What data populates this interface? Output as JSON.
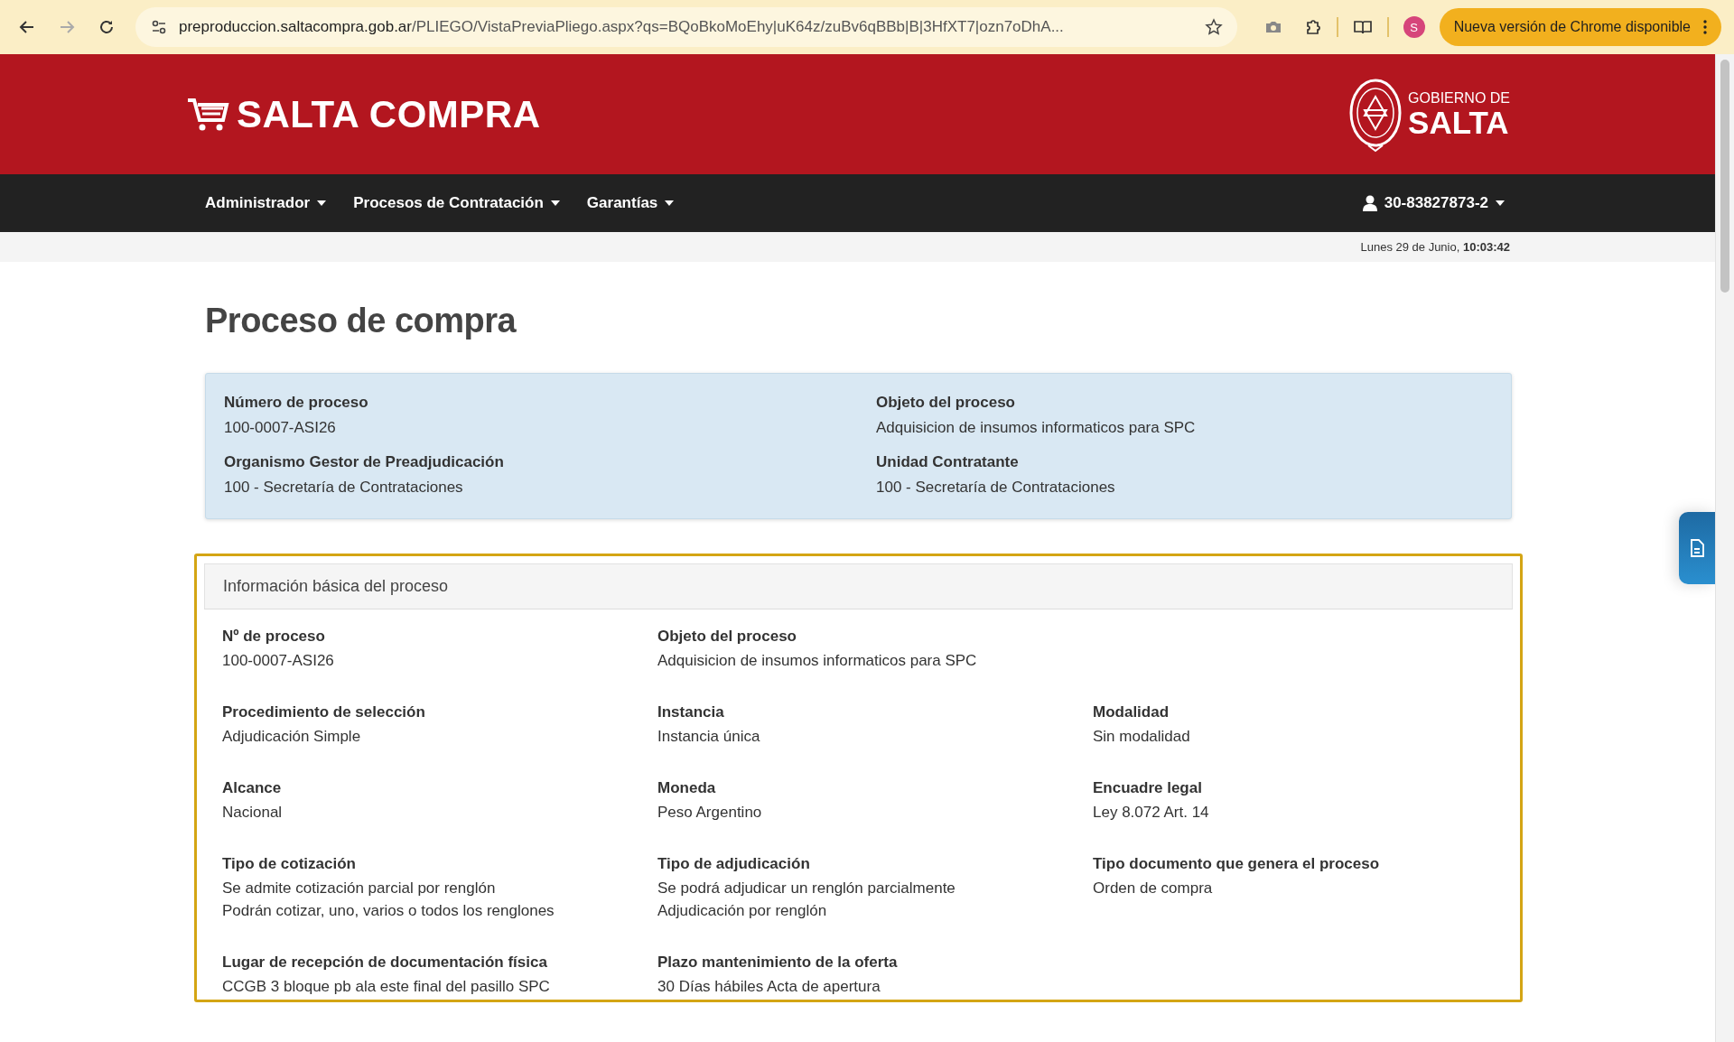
{
  "browser": {
    "url_host": "preproduccion.saltacompra.gob.ar",
    "url_path": "/PLIEGO/VistaPreviaPliego.aspx?qs=BQoBkoMoEhy|uK64z/zuBv6qBBb|B|3HfXT7|ozn7oDhA...",
    "profile": "S",
    "update_button": "Nueva versión de Chrome disponible"
  },
  "header": {
    "logo": "SALTA COMPRA",
    "gov_line1": "GOBIERNO DE",
    "gov_line2": "SALTA"
  },
  "nav": {
    "items": [
      {
        "label": "Administrador"
      },
      {
        "label": "Procesos de Contratación"
      },
      {
        "label": "Garantías"
      }
    ],
    "user": "30-83827873-2"
  },
  "date": "Lunes 29 de Junio, **10:03:42**",
  "title": "Proceso de compra",
  "summary": [
    {
      "label": "Número de proceso",
      "value": "100-0007-ASI26"
    },
    {
      "label": "Objeto del proceso",
      "value": "Adquisicion de insumos informaticos para SPC"
    },
    {
      "label": "Organismo Gestor de Preadjudicación",
      "value": "100 - Secretaría de Contrataciones"
    },
    {
      "label": "Unidad Contratante",
      "value": "100 - Secretaría de Contrataciones"
    }
  ],
  "panel": {
    "title": "Información básica del proceso",
    "rows": [
      [
        {
          "label": "Nº de proceso",
          "values": [
            "100-0007-ASI26"
          ]
        },
        {
          "label": "Objeto del proceso",
          "values": [
            "Adquisicion de insumos informaticos para SPC"
          ]
        }
      ],
      [
        {
          "label": "Procedimiento de selección",
          "values": [
            "Adjudicación Simple"
          ]
        },
        {
          "label": "Instancia",
          "values": [
            "Instancia única"
          ]
        },
        {
          "label": "Modalidad",
          "values": [
            "Sin modalidad"
          ]
        }
      ],
      [
        {
          "label": "Alcance",
          "values": [
            "Nacional"
          ]
        },
        {
          "label": "Moneda",
          "values": [
            "Peso Argentino"
          ]
        },
        {
          "label": "Encuadre legal",
          "values": [
            "Ley 8.072 Art. 14"
          ]
        }
      ],
      [
        {
          "label": "Tipo de cotización",
          "values": [
            "Se admite cotización parcial por renglón",
            "Podrán cotizar, uno, varios o todos los renglones"
          ]
        },
        {
          "label": "Tipo de adjudicación",
          "values": [
            "Se podrá adjudicar un renglón parcialmente",
            "Adjudicación por renglón"
          ]
        },
        {
          "label": "Tipo documento que genera el proceso",
          "values": [
            "Orden de compra"
          ]
        }
      ],
      [
        {
          "label": "Lugar de recepción de documentación física",
          "values": [
            "CCGB 3 bloque pb ala este final del pasillo SPC"
          ]
        },
        {
          "label": "Plazo mantenimiento de la oferta",
          "values": [
            "30 Días hábiles Acta de apertura"
          ]
        }
      ]
    ]
  }
}
